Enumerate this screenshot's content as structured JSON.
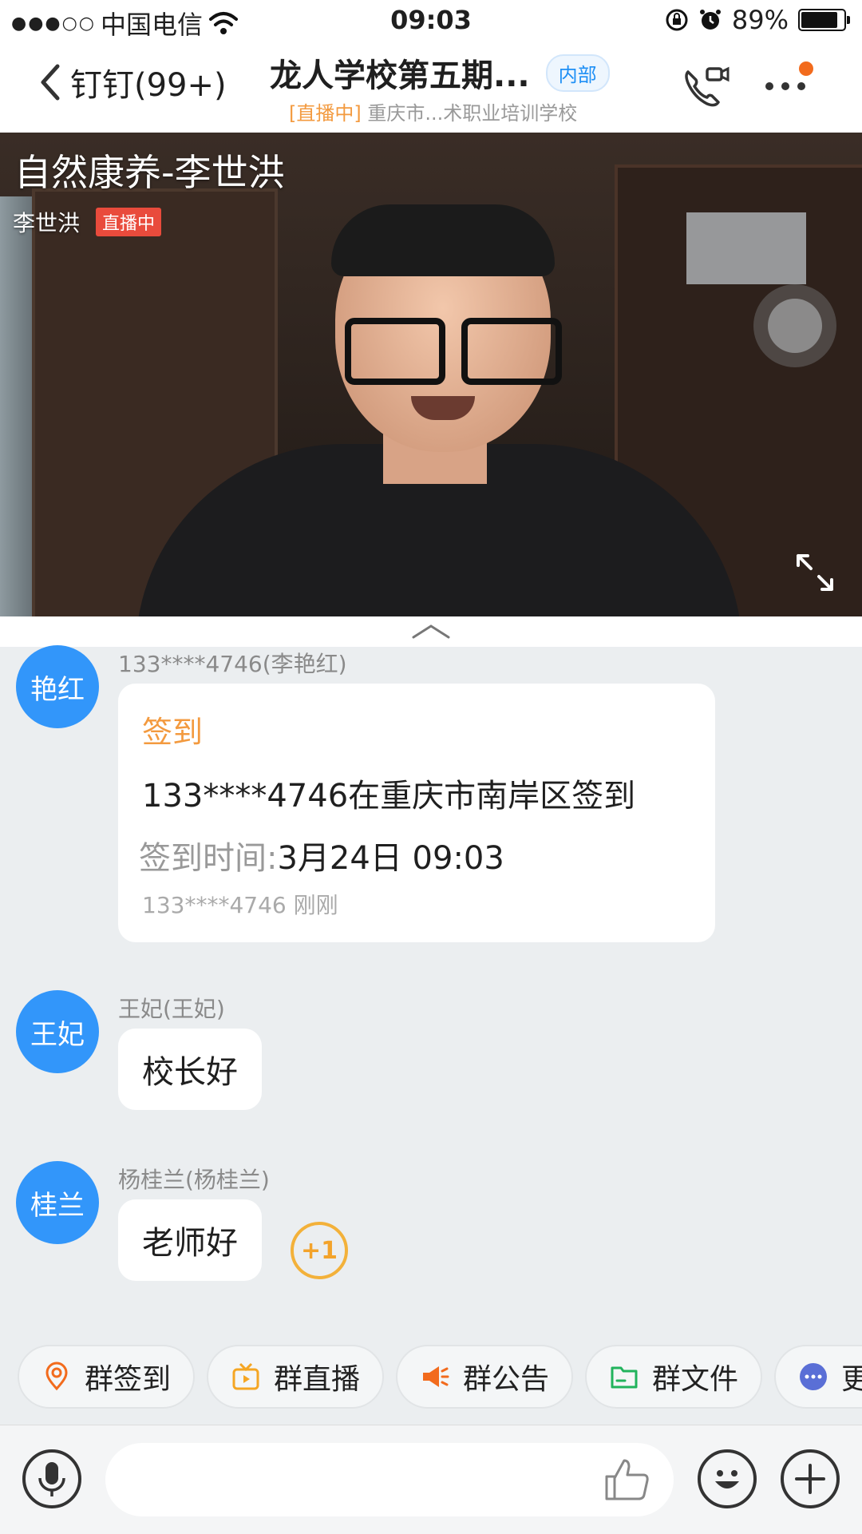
{
  "status_bar": {
    "signal": "●●●○○",
    "carrier": "中国电信",
    "time": "09:03",
    "battery_text": "89%",
    "battery_level": 0.89
  },
  "nav": {
    "back_label": "钉钉(99+)",
    "title": "龙人学校第五期...",
    "badge": "内部",
    "subtitle_status": "[直播中]",
    "subtitle_org": "重庆市...术职业培训学校"
  },
  "video": {
    "title": "自然康养-李世洪",
    "host": "李世洪",
    "live_badge": "直播中"
  },
  "messages": [
    {
      "avatar": "艳红",
      "sender": "133****4746(李艳红)",
      "type": "checkin",
      "label": "签到",
      "text": "133****4746在重庆市南岸区签到",
      "time_label": "签到时间:",
      "time_value": "3月24日 09:03",
      "footer": "133****4746  刚刚"
    },
    {
      "avatar": "王妃",
      "sender": "王妃(王妃)",
      "type": "text",
      "text": "校长好"
    },
    {
      "avatar": "桂兰",
      "sender": "杨桂兰(杨桂兰)",
      "type": "text",
      "text": "老师好",
      "reaction": "+1"
    }
  ],
  "quick_actions": [
    {
      "label": "群签到",
      "icon": "location-pin-icon",
      "color": "#f26b1d"
    },
    {
      "label": "群直播",
      "icon": "tv-icon",
      "color": "#f5a623"
    },
    {
      "label": "群公告",
      "icon": "megaphone-icon",
      "color": "#f26b1d"
    },
    {
      "label": "群文件",
      "icon": "folder-icon",
      "color": "#21b35c"
    },
    {
      "label": "更",
      "icon": "more-dots-icon",
      "color": "#5a6fd6"
    }
  ],
  "input": {
    "placeholder": ""
  },
  "colors": {
    "brand_blue": "#3296fa",
    "accent_orange": "#f39a3f",
    "live_red": "#e94b3c",
    "chat_background": "#ebeef0"
  }
}
